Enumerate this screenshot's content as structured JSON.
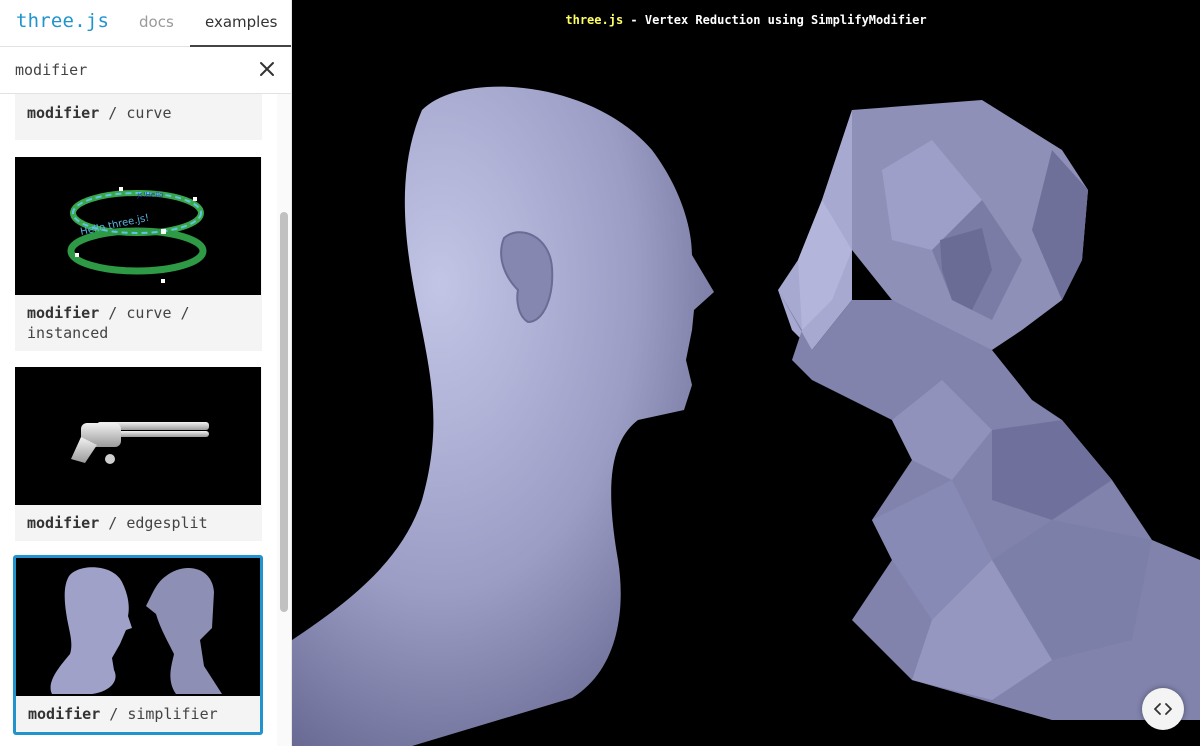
{
  "header": {
    "logo": "three.js",
    "tabs": [
      {
        "label": "docs",
        "active": false
      },
      {
        "label": "examples",
        "active": true
      }
    ]
  },
  "filter": {
    "value": "modifier",
    "clear_icon": "close-icon"
  },
  "examples": [
    {
      "category": "modifier",
      "rest": " / curve",
      "selected": false
    },
    {
      "category": "modifier",
      "rest": " / curve / instanced",
      "selected": false
    },
    {
      "category": "modifier",
      "rest": " / edgesplit",
      "selected": false
    },
    {
      "category": "modifier",
      "rest": " / simplifier",
      "selected": true
    }
  ],
  "viewport": {
    "info_link": "three.js",
    "info_text": " - Vertex Reduction using SimplifyModifier",
    "code_button_icon": "code-icon"
  },
  "colors": {
    "accent": "#2194ce",
    "link_yellow": "#ffff66",
    "mesh": "#9a9cc4",
    "background": "#000000"
  }
}
